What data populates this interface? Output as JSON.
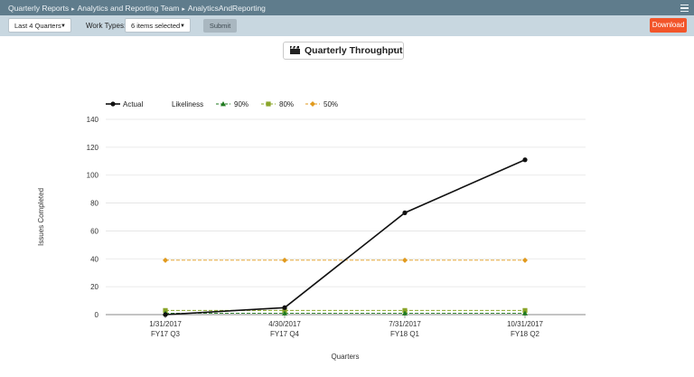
{
  "header": {
    "breadcrumb": [
      "Quarterly Reports",
      "Analytics and Reporting Team",
      "AnalyticsAndReporting"
    ],
    "separator": "▸",
    "menu_icon": "hamburger-menu-icon"
  },
  "toolbar": {
    "period_select": "Last 4 Quarters",
    "work_types_label": "Work Types:",
    "work_types_select": "6 items selected",
    "submit_label": "Submit",
    "download_label": "Download"
  },
  "chart_selector": {
    "icon": "clapperboard-icon",
    "label": "Quarterly Throughput"
  },
  "chart_data": {
    "type": "line",
    "title": "",
    "xlabel": "Quarters",
    "ylabel": "Issues Completed",
    "ylim": [
      0,
      140
    ],
    "yticks": [
      0,
      20,
      40,
      60,
      80,
      100,
      120,
      140
    ],
    "grid": true,
    "legend_placement": "top-left",
    "legend_group_label": "Likeliness",
    "categories": [
      {
        "date": "1/31/2017",
        "quarter": "FY17 Q3"
      },
      {
        "date": "4/30/2017",
        "quarter": "FY17 Q4"
      },
      {
        "date": "7/31/2017",
        "quarter": "FY18 Q1"
      },
      {
        "date": "10/31/2017",
        "quarter": "FY18 Q2"
      }
    ],
    "series": [
      {
        "name": "Actual",
        "values": [
          0,
          5,
          73,
          111
        ],
        "color": "#111111",
        "marker": "circle",
        "dash": false
      },
      {
        "name": "90%",
        "values": [
          1,
          1,
          1,
          1
        ],
        "color": "#1f7a1f",
        "marker": "triangle",
        "dash": true
      },
      {
        "name": "80%",
        "values": [
          3,
          3,
          3,
          3
        ],
        "color": "#8aa52a",
        "marker": "square",
        "dash": true
      },
      {
        "name": "50%",
        "values": [
          39,
          39,
          39,
          39
        ],
        "color": "#e19a1e",
        "marker": "diamond",
        "dash": true
      }
    ]
  }
}
